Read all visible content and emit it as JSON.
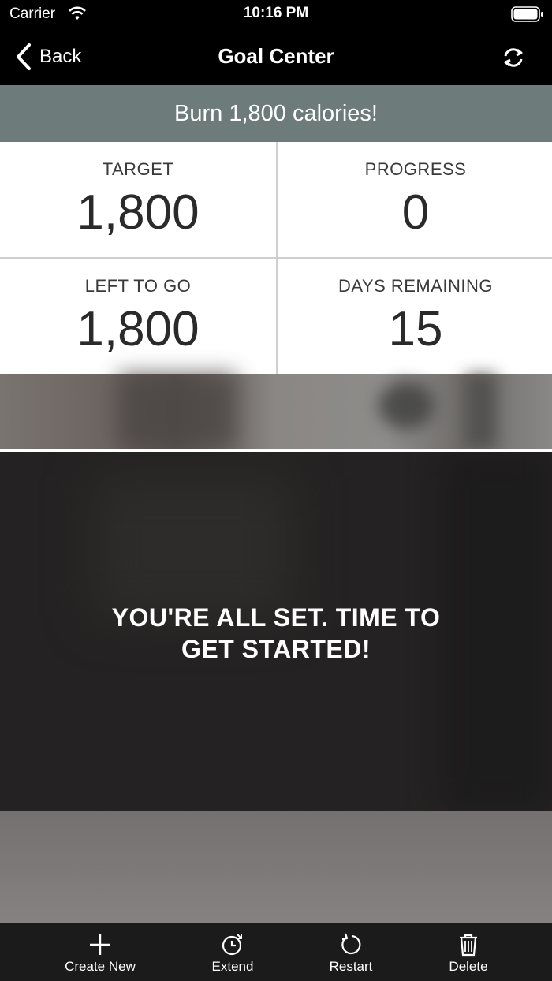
{
  "status_bar": {
    "carrier": "Carrier",
    "time": "10:16 PM"
  },
  "nav": {
    "back_label": "Back",
    "title": "Goal Center"
  },
  "goal": {
    "banner": "Burn 1,800 calories!"
  },
  "stats": {
    "target": {
      "label": "TARGET",
      "value": "1,800"
    },
    "progress": {
      "label": "PROGRESS",
      "value": "0"
    },
    "left": {
      "label": "LEFT TO GO",
      "value": "1,800"
    },
    "days": {
      "label": "DAYS REMAINING",
      "value": "15"
    }
  },
  "message": {
    "line1": "YOU'RE ALL SET. TIME TO",
    "line2": "GET STARTED!"
  },
  "toolbar": {
    "create_label": "Create New",
    "extend_label": "Extend",
    "restart_label": "Restart",
    "delete_label": "Delete"
  },
  "icons": [
    "wifi-icon",
    "battery-icon",
    "chevron-left-icon",
    "refresh-icon",
    "plus-icon",
    "clock-icon",
    "restart-icon",
    "trash-icon"
  ],
  "colors": {
    "banner": "#6e7b7b",
    "toolbar": "#1b1b1b",
    "panel": "#242222"
  }
}
